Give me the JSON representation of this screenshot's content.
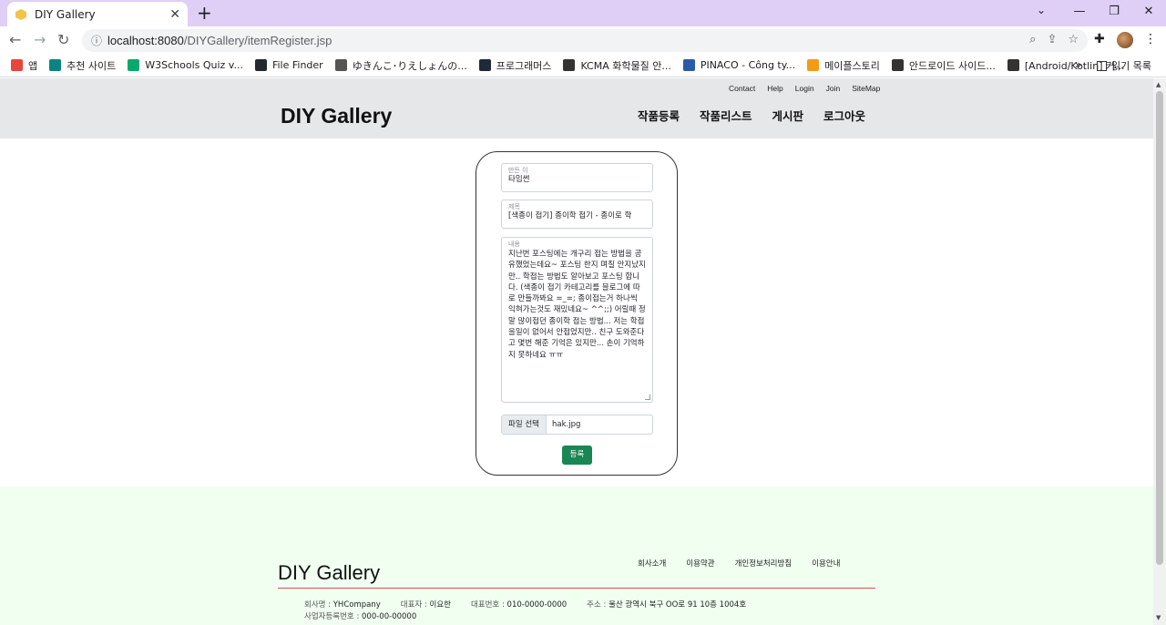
{
  "browser": {
    "tab_title": "DIY Gallery",
    "url_host": "localhost:8080",
    "url_path": "/DIYGallery/itemRegister.jsp",
    "bookmarks": [
      {
        "label": "앱",
        "icon": "apps-grid-icon",
        "color": "#e8453c"
      },
      {
        "label": "추천 사이트",
        "icon": "bing-icon",
        "color": "#0c8484"
      },
      {
        "label": "W3Schools Quiz v...",
        "icon": "w3schools-icon",
        "color": "#04aa6d"
      },
      {
        "label": "File Finder",
        "icon": "github-icon",
        "color": "#24292f"
      },
      {
        "label": "ゆきんこ･りえしょんの...",
        "icon": "blog-icon",
        "color": "#555555"
      },
      {
        "label": "프로그래머스",
        "icon": "programmers-icon",
        "color": "#1e2a3a"
      },
      {
        "label": "KCMA 화학물질 안...",
        "icon": "globe-icon",
        "color": "#333333"
      },
      {
        "label": "PINACO - Công ty...",
        "icon": "pinaco-icon",
        "color": "#2b5aa8"
      },
      {
        "label": "메이플스토리",
        "icon": "maple-icon",
        "color": "#f39c12"
      },
      {
        "label": "안드로이드 사이드...",
        "icon": "dots-icon",
        "color": "#333333"
      },
      {
        "label": "[Android/Kotlin] 커...",
        "icon": "dots-icon",
        "color": "#333333"
      }
    ],
    "more": "»",
    "reading_list": "읽기 목록"
  },
  "site": {
    "brand": "DIY Gallery",
    "util_links": [
      "Contact",
      "Help",
      "Login",
      "Join",
      "SiteMap"
    ],
    "nav": [
      "작품등록",
      "작품리스트",
      "게시판",
      "로그아웃"
    ]
  },
  "form": {
    "maker_label": "만든 이",
    "maker_value": "타임썬",
    "title_label": "제목",
    "title_value": "[색종이 접기] 종이학 접기 - 종이로 학",
    "content_label": "내용",
    "content_value": "지난번 포스팅에는 개구리 접는 방법을 공유했었는데요~ 포스팅 한지 며칠 안지났지만.. 학접는 방법도 알아보고 포스팅 합니다. (색종이 접기 카테고리를 블로그에 따로 만들까봐요 =_=; 종이접는거 하나씩 익혀가는것도 재밌네요~ ^^;;) 어릴때 정말 많이접던 종이학 접는 방법... 저는 학접을일이 없어서 안접었지만.. 친구 도와준다고 몇번 해준 기억은 있지만... 손이 기억하지 못하네요 ㅠㅠ",
    "file_button": "파일 선택",
    "file_name": "hak.jpg",
    "submit": "등록"
  },
  "footer": {
    "brand": "DIY Gallery",
    "links": [
      "회사소개",
      "이용약관",
      "개인정보처리방침",
      "이용안내"
    ],
    "company_label": "회사명 :",
    "company": "YHCompany",
    "ceo_label": "대표자 :",
    "ceo": "이요한",
    "phone_label": "대표번호 :",
    "phone": "010-0000-0000",
    "address_label": "주소 :",
    "address": "울산 광역시 북구 OO로 91 10층 1004호",
    "bizno_label": "사업자등록번호 :",
    "bizno": "000-00-00000"
  },
  "colors": {
    "tabbar": "#dfcff6",
    "header_bg": "#e5e7e9",
    "footer_bg": "#f0fff0",
    "submit_bg": "#198754",
    "footer_rule": "#d9534f"
  }
}
